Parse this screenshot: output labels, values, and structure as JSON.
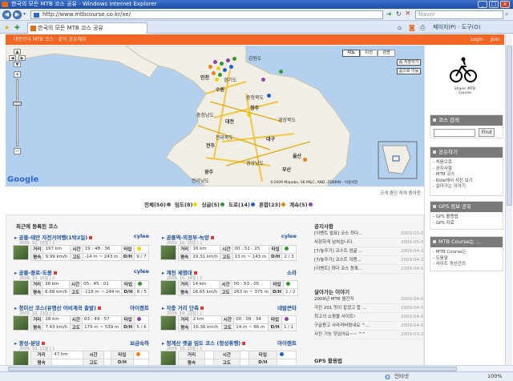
{
  "window": {
    "title": "한국의 모든 MTB 코스 공유 - Windows Internet Explorer"
  },
  "browser": {
    "url": "http://www.mtbcourse.co.kr/xe/",
    "search_placeholder": "Naver",
    "tab_title": "한국의 모든 MTB 코스 공유",
    "page_menu": "페이지(P)",
    "tools_menu": "도구(O)"
  },
  "site": {
    "header_text": "대한민국 MTB 코스 · 같이 공유해요",
    "login": "Login",
    "join": "Join",
    "logo_text": "Share! MTB Course"
  },
  "map": {
    "type_buttons": [
      "지도",
      "위성",
      "겸용"
    ],
    "buttons": [
      "숨 처장하기",
      "줌으로 이동"
    ],
    "copyright": "©2009 Mapabc, SK M&C, AND, ZENRIN - 이용약관",
    "note": "크게 줌인 작게 줌아웃",
    "cities": [
      "강원도",
      "인천",
      "경기도",
      "수원",
      "충청북도",
      "청주",
      "대전",
      "충청남도",
      "전라북도",
      "전주",
      "경상북도",
      "대구",
      "울산",
      "부산",
      "광주",
      "전라남도",
      "경상남도"
    ],
    "logo": "Google"
  },
  "legend": {
    "items": [
      {
        "label": "전체(50)",
        "color": "#666666"
      },
      {
        "label": "임도(8)",
        "color": "#f0d000"
      },
      {
        "label": "싱글(5)",
        "color": "#2e9a2e"
      },
      {
        "label": "도로(14)",
        "color": "#1e5fd0"
      },
      {
        "label": "혼합(23)",
        "color": "#f08010"
      },
      {
        "label": "계속(5)",
        "color": "#8e44ad"
      }
    ]
  },
  "courses": {
    "heading": "최근에 등록된 코스",
    "labels": {
      "dist": "거리",
      "time": "시간",
      "type": "타입",
      "avg": "평속",
      "alt": "고도",
      "dh": "D/H"
    },
    "items": [
      {
        "title": "공릉-태안 자전거여행(1박2일)",
        "author": "cylee",
        "date": "2009. 10. 15일 | 1",
        "dist": "197 km",
        "time": "19 : 48 : 36",
        "avg": "9.99 km/h",
        "alt": "-14 m ~ 243 m",
        "dh": "9 / 7"
      },
      {
        "title": "공릉역-의정부-녹양",
        "author": "cylee",
        "date": "2009. 10. 15일 | 1",
        "dist": "16 km",
        "time": "00 : 52 : 25",
        "avg": "19.31 km/h",
        "alt": "13 m ~ 143 m",
        "dh": "2 / 3"
      },
      {
        "title": "공릉-중로-도봉",
        "author": "cylee",
        "date": "2009. 10. 15일 | 1",
        "dist": "38 km",
        "time": "05 : 45 : 01",
        "avg": "6.68 km/h",
        "alt": "-118 m ~ 244 m",
        "dh": "8 / 5"
      },
      {
        "title": "계천 세명대",
        "author": "소라",
        "date": "2009. 10. 14일 | 1",
        "dist": "14 km",
        "time": "00 : 53 : 05",
        "avg": "16.65 km/h",
        "alt": "263 m ~ 375 m",
        "dh": "1 / 2"
      },
      {
        "title": "청미산 코스(유명산 어비계곡 출발)",
        "author": "아이렌트",
        "date": "2009. 10. 13일 | 1",
        "dist": "28 km",
        "time": "03 : 49 : 57",
        "avg": "7.43 km/h",
        "alt": "179 m ~ 539 m",
        "dh": "5 / 6"
      },
      {
        "title": "자충 거리 단축",
        "author": "네발큰타",
        "date": "2009. 10. 12일 | 1",
        "dist": "2 km",
        "time": "00 : 09 : 34",
        "avg": "16.36 km/h",
        "alt": "14 m ~ 66 m",
        "dh": "1 / 1"
      },
      {
        "title": "광성-분당",
        "author": "보금숙하",
        "date": "2009. 10. 11일 | 1",
        "dist": "47 km",
        "time": "",
        "avg": "",
        "alt": "",
        "dh": ""
      },
      {
        "title": "청계산 옛골 임도 코스 (청성휴행)",
        "author": "아이렌트",
        "date": "2009. 10. 10일 | 1",
        "dist": "",
        "time": "",
        "avg": "",
        "alt": "",
        "dh": ""
      }
    ]
  },
  "notice": {
    "heading": "공지사항",
    "items": [
      {
        "text": "[이벤트 발표] 코스 최다...",
        "date": "2009-05-08"
      },
      {
        "text": "사정하게 넘쳐습니다.",
        "date": "2009-05-01"
      },
      {
        "text": "[7/놓주기] 코스트 엄굴 ...",
        "date": "2009-04-29"
      },
      {
        "text": "[7/놓주기] 코스트 이용...",
        "date": "2009-04-20"
      },
      {
        "text": "[이벤트] 최다 코스 등록...",
        "date": "2009-04-10"
      }
    ]
  },
  "talk": {
    "heading": "살아가는 이야기",
    "items": [
      {
        "text": "2009년 MTB 월간지",
        "date": "2009-04-07"
      },
      {
        "text": "가진 201 맛이 잡겠고 합 ...",
        "date": "2009-04-07"
      },
      {
        "text": "최고의 쇼핑몰 사이트!",
        "date": "2009-04-03"
      },
      {
        "text": "구글용고 사라져버렸네요 ^...",
        "date": "2009-04-02"
      },
      {
        "text": "사진 기능 덧있어요~~ ^^",
        "date": "2009-03-26"
      }
    ]
  },
  "gps_use": {
    "heading": "GPS 활용법"
  },
  "sidebar": {
    "search": {
      "heading": "코스 검색",
      "button": "Find"
    },
    "share": {
      "heading": "공유하기",
      "items": [
        "- 처음으로",
        "- 공지사항",
        "- MTB 코스",
        "- Ride에서 사진 보기",
        "- 살아가는 이야기"
      ]
    },
    "gps": {
      "heading": "GPS 정보 공유",
      "items": [
        "- GPS 활용법",
        "- GPS 자료"
      ]
    },
    "about": {
      "heading": "MTB Course는 ...",
      "items": [
        "- MTB Course는",
        "- 도움말",
        "- 사이트 개선건의"
      ]
    }
  },
  "status": {
    "zone": "인터넷",
    "zoom": "100%"
  }
}
